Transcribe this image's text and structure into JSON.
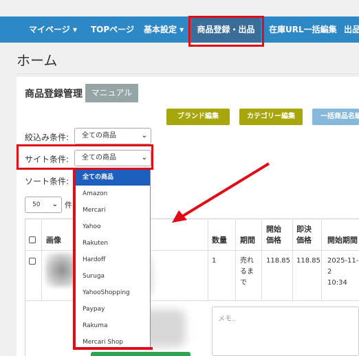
{
  "nav": {
    "items": [
      "マイページ ▾",
      "TOPページ",
      "基本設定 ▾",
      "商品登録・出品",
      "在庫URL一括編集",
      "出品"
    ]
  },
  "page": {
    "title": "ホーム"
  },
  "section": {
    "title": "商品登録管理",
    "manual_button": "マニュアル"
  },
  "actions": {
    "brand_edit": "ブランド編集",
    "category_edit": "カテゴリー編集",
    "bulk_name_edit": "一括商品名編集"
  },
  "filters": {
    "narrow_label": "絞込み条件:",
    "narrow_value": "全ての商品",
    "site_label": "サイト条件:",
    "site_value": "全ての商品",
    "sort_label": "ソート条件:",
    "per_page_value": "50",
    "per_page_suffix": "件"
  },
  "site_dropdown": {
    "options": [
      "全ての商品",
      "Amazon",
      "Mercari",
      "Yahoo",
      "Rakuten",
      "Hardoff",
      "Suruga",
      "YahooShopping",
      "Paypay",
      "Rakuma",
      "Mercari Shop"
    ],
    "selected": "全ての商品"
  },
  "table": {
    "headers": {
      "image": "画像",
      "quantity": "数量",
      "period": "期間",
      "start_price": "開始\n価格",
      "buyout_price": "即決\n価格",
      "start_period": "開始期間"
    },
    "rows": [
      {
        "quantity": "1",
        "period": "売れ\nるま\nで",
        "start_price": "118.85",
        "buyout_price": "118.85",
        "start_period": "2025-11-2\n10:34"
      }
    ]
  },
  "memo_placeholder": "メモ..",
  "colors": {
    "navbar": "#2e88c6",
    "highlight": "#e00d17",
    "olive_button": "#a8a60d",
    "selected_option": "#1d5fbf"
  }
}
